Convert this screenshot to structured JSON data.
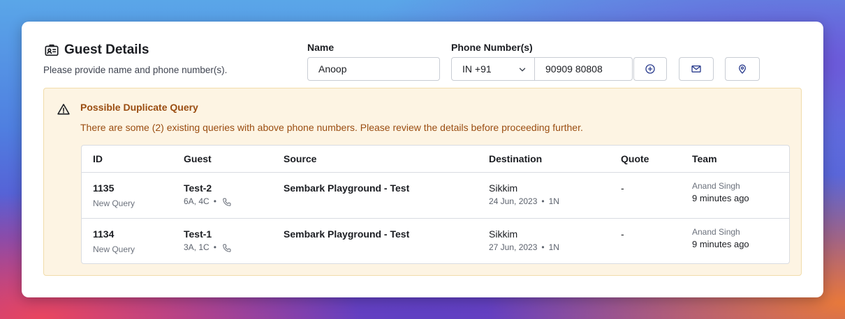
{
  "header": {
    "title": "Guest Details",
    "subtitle": "Please provide name and phone number(s)."
  },
  "form": {
    "name_label": "Name",
    "name_value": "Anoop",
    "phone_label": "Phone Number(s)",
    "country_code": "IN +91",
    "phone_value": "90909 80808"
  },
  "icons": {
    "title": "id-card-icon",
    "add": "plus-circle-icon",
    "email": "envelope-icon",
    "location": "map-pin-icon",
    "alert": "warning-triangle-icon",
    "phone": "phone-icon",
    "caret": "chevron-down-icon"
  },
  "colors": {
    "alert_bg": "#fdf4e3",
    "alert_border": "#f1dcaa",
    "alert_text": "#9a4d11",
    "icon_blue": "#2c3e8f"
  },
  "alert": {
    "title": "Possible Duplicate Query",
    "message": "There are some (2) existing queries with above phone numbers. Please review the details before proceeding further."
  },
  "table": {
    "headers": [
      "ID",
      "Guest",
      "Source",
      "Destination",
      "Quote",
      "Team"
    ],
    "rows": [
      {
        "id": "1135",
        "status": "New Query",
        "guest": "Test-2",
        "pax": "6A, 4C",
        "source": "Sembark Playground - Test",
        "destination": "Sikkim",
        "date": "24 Jun, 2023",
        "nights": "1N",
        "quote": "-",
        "team_member": "Anand Singh",
        "time": "9 minutes ago"
      },
      {
        "id": "1134",
        "status": "New Query",
        "guest": "Test-1",
        "pax": "3A, 1C",
        "source": "Sembark Playground - Test",
        "destination": "Sikkim",
        "date": "27 Jun, 2023",
        "nights": "1N",
        "quote": "-",
        "team_member": "Anand Singh",
        "time": "9 minutes ago"
      }
    ]
  }
}
